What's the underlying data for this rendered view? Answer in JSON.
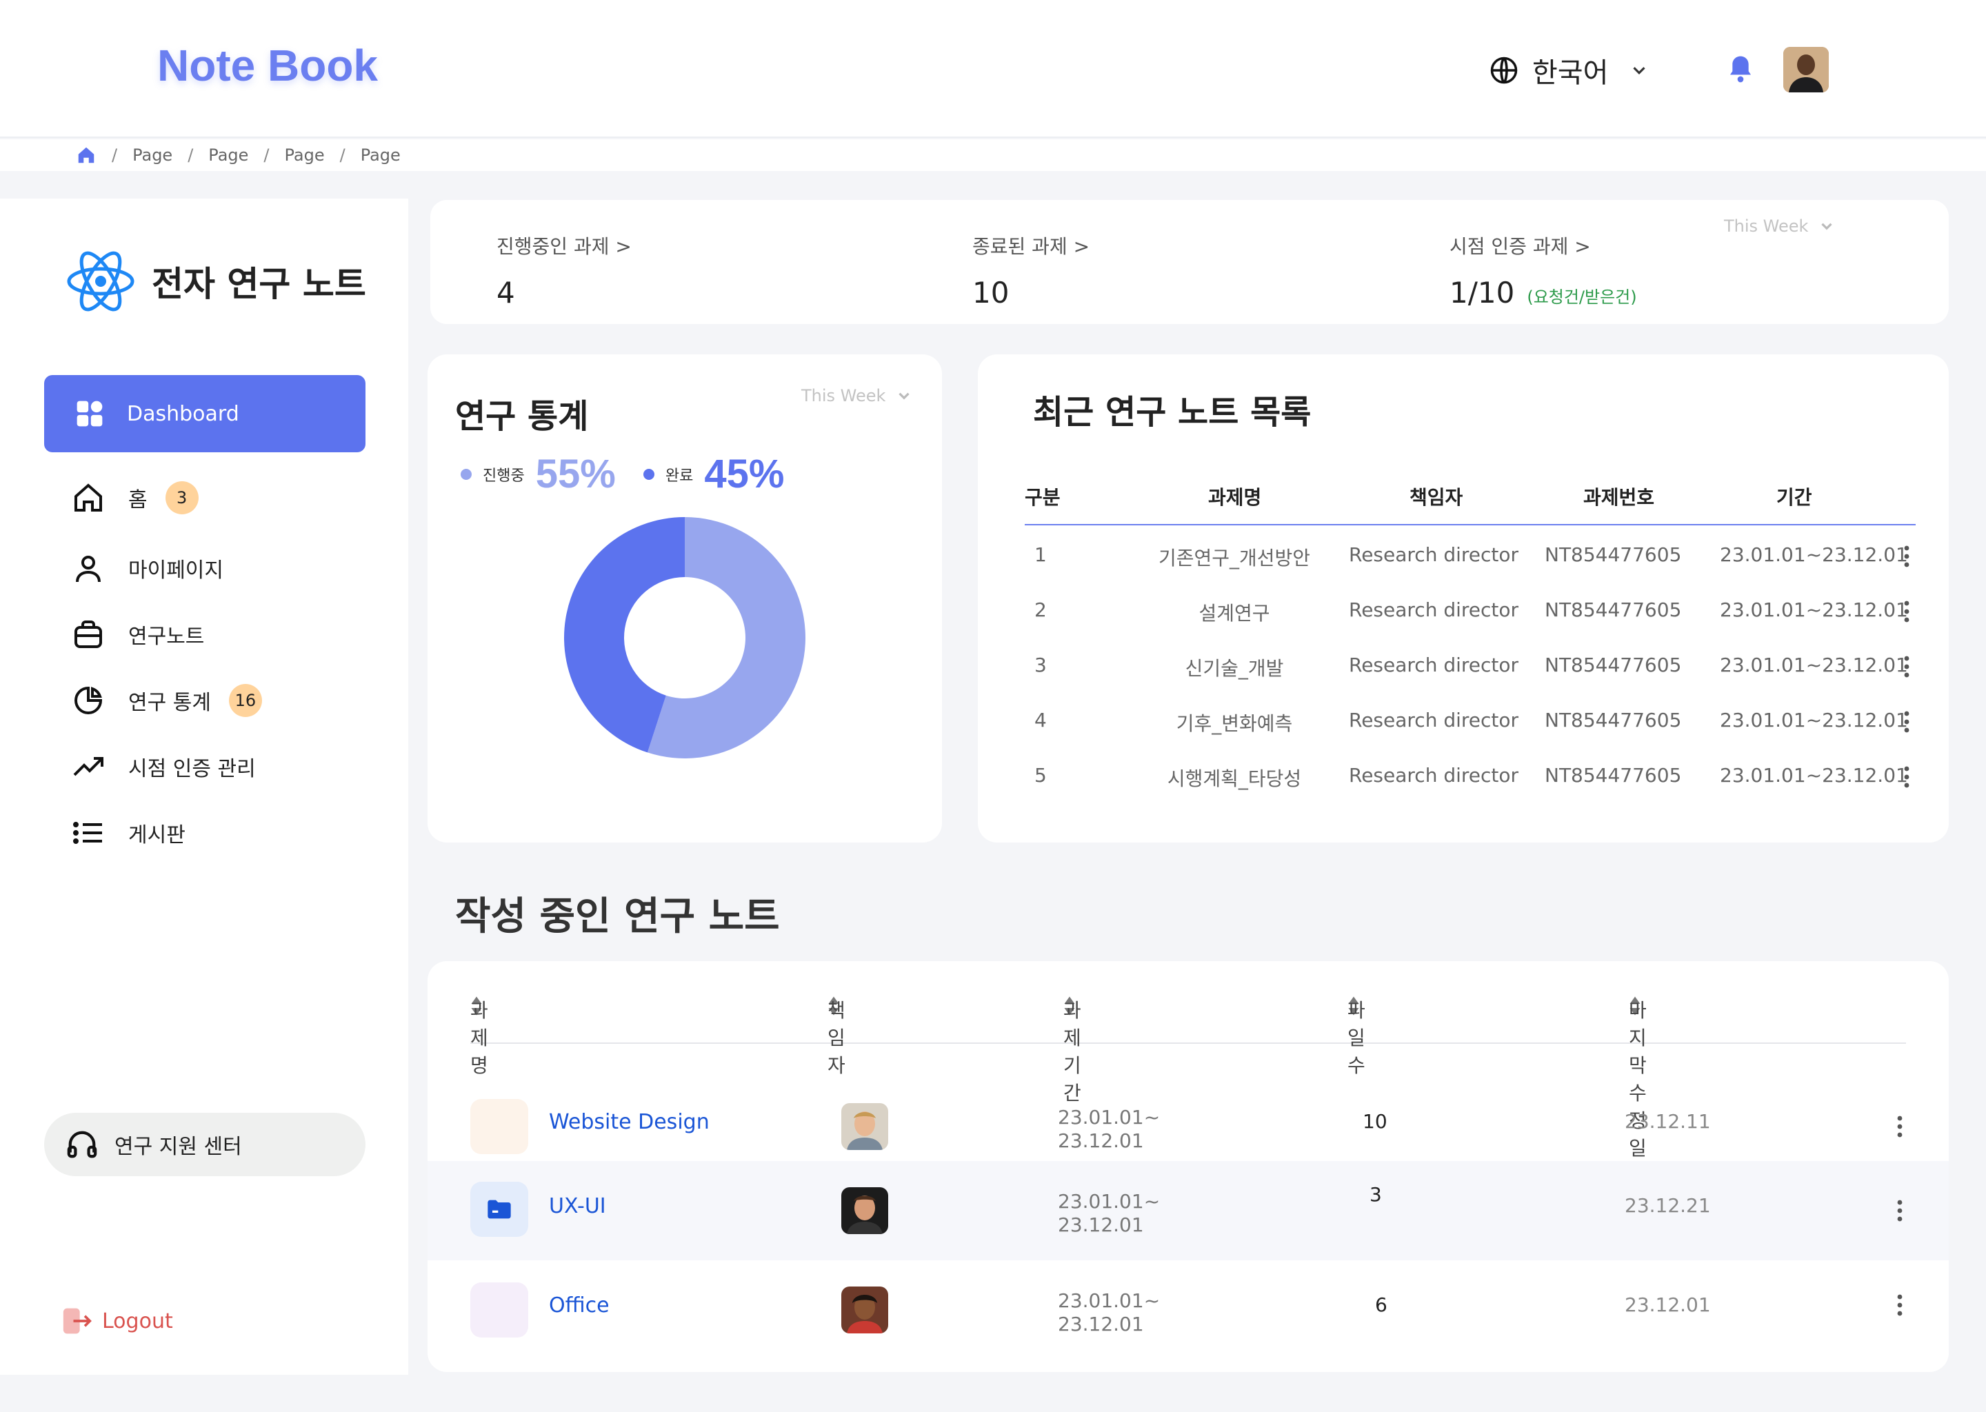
{
  "header": {
    "logo": "Note Book",
    "language": "한국어"
  },
  "breadcrumb": [
    "Page",
    "Page",
    "Page",
    "Page"
  ],
  "sidebar": {
    "brand": "전자 연구 노트",
    "active_item": "Dashboard",
    "items": [
      {
        "label": "홈",
        "badge": "3",
        "icon": "home-icon"
      },
      {
        "label": "마이페이지",
        "badge": "",
        "icon": "user-icon"
      },
      {
        "label": "연구노트",
        "badge": "",
        "icon": "briefcase-icon"
      },
      {
        "label": "연구 통계",
        "badge": "16",
        "icon": "pie-chart-icon"
      },
      {
        "label": "시점 인증 관리",
        "badge": "",
        "icon": "trending-up-icon"
      },
      {
        "label": "게시판",
        "badge": "",
        "icon": "list-icon"
      }
    ],
    "support": "연구 지원 센터",
    "logout": "Logout"
  },
  "summary": {
    "filter": "This Week",
    "items": [
      {
        "label": "진행중인 과제 >",
        "value": "4"
      },
      {
        "label": "종료된 과제 >",
        "value": "10"
      },
      {
        "label": "시점 인증 과제 >",
        "value": "1/10",
        "note": "(요청건/받은건)"
      }
    ]
  },
  "stats": {
    "title": "연구 통계",
    "filter": "This Week",
    "legend": [
      {
        "label": "진행중",
        "value": "55%",
        "color": "#97a6ee"
      },
      {
        "label": "완료",
        "value": "45%",
        "color": "#5c73ee"
      }
    ]
  },
  "chart_data": {
    "type": "pie",
    "categories": [
      "진행중",
      "완료"
    ],
    "values": [
      55,
      45
    ],
    "colors": [
      "#97a6ee",
      "#5c73ee"
    ],
    "donut": true
  },
  "recent": {
    "title": "최근 연구 노트 목록",
    "columns": [
      "구분",
      "과제명",
      "책임자",
      "과제번호",
      "기간"
    ],
    "rows": [
      [
        "1",
        "기존연구_개선방안",
        "Research director",
        "NT854477605",
        "23.01.01~23.12.01"
      ],
      [
        "2",
        "설계연구",
        "Research director",
        "NT854477605",
        "23.01.01~23.12.01"
      ],
      [
        "3",
        "신기술_개발",
        "Research director",
        "NT854477605",
        "23.01.01~23.12.01"
      ],
      [
        "4",
        "기후_변화예측",
        "Research director",
        "NT854477605",
        "23.01.01~23.12.01"
      ],
      [
        "5",
        "시행계획_타당성",
        "Research director",
        "NT854477605",
        "23.01.01~23.12.01"
      ]
    ]
  },
  "notes": {
    "title": "작성 중인 연구 노트",
    "columns": [
      "과제명",
      "책임자",
      "과제기간",
      "파일 수",
      "마지막 수정일"
    ],
    "rows": [
      {
        "name": "Website Design",
        "period_start": "23.01.01~",
        "period_end": "23.12.01",
        "files": "10",
        "modified": "23.12.11",
        "icon_color": "#fdf3ea"
      },
      {
        "name": "UX-UI",
        "period_start": "23.01.01~",
        "period_end": "23.12.01",
        "files": "3",
        "modified": "23.12.21",
        "icon_color": "#e3ecfb"
      },
      {
        "name": "Office",
        "period_start": "23.01.01~",
        "period_end": "23.12.01",
        "files": "6",
        "modified": "23.12.01",
        "icon_color": "#f5eefa"
      }
    ]
  }
}
